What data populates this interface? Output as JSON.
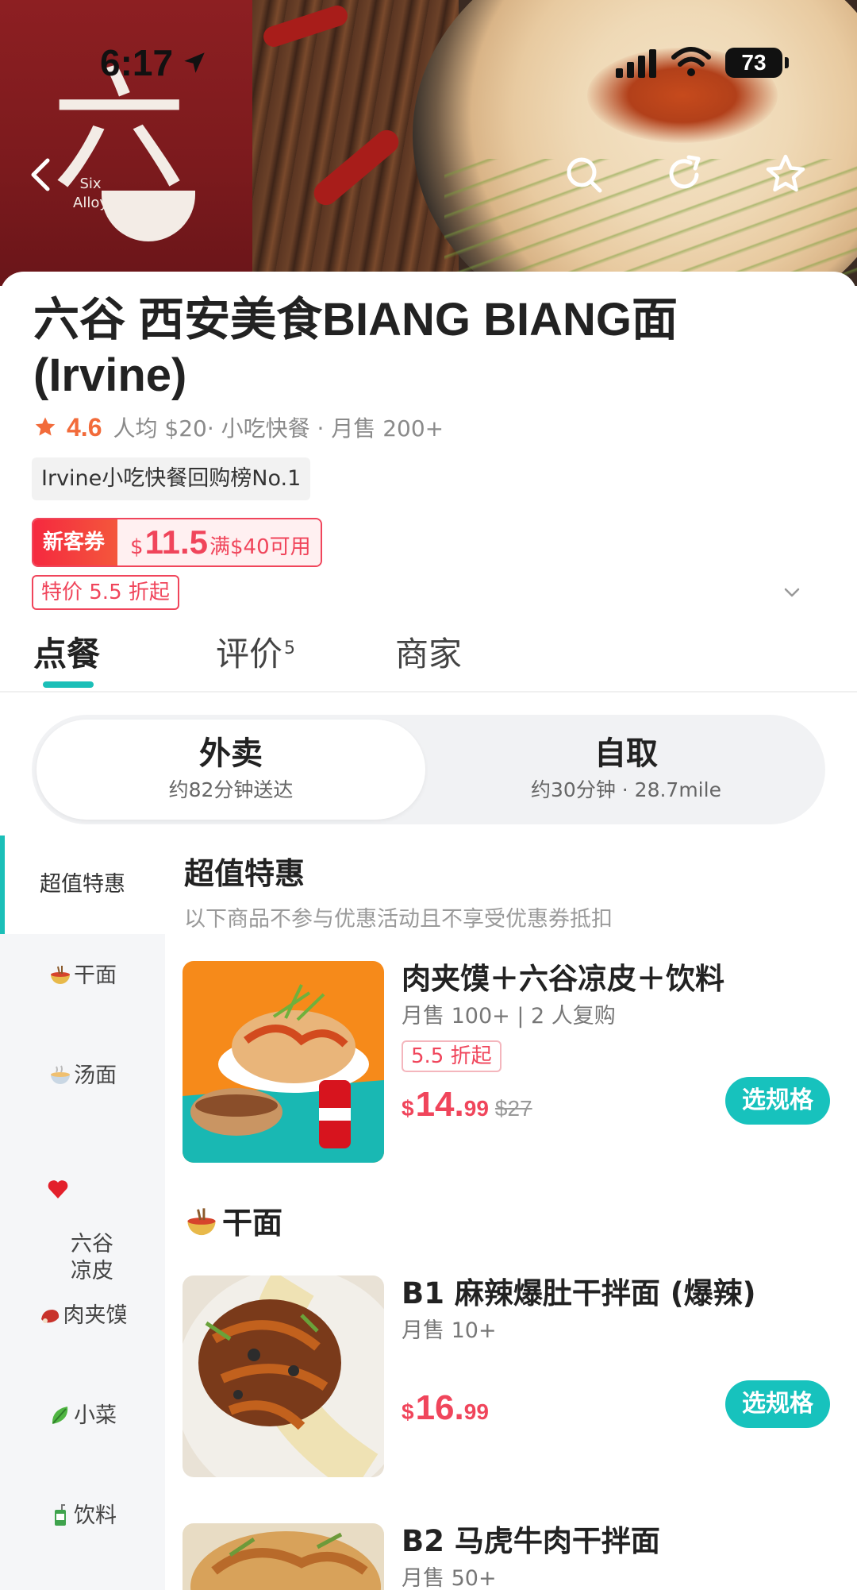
{
  "status_bar": {
    "time": "6:17",
    "battery": "73"
  },
  "hero": {
    "logo_glyph": "六",
    "logo_sub": "Six Alloy",
    "icons": [
      "back-icon",
      "search-icon",
      "share-icon",
      "favorite-star-icon"
    ]
  },
  "store": {
    "title": "六谷 西安美食BIANG BIANG面 (Irvine)",
    "rating": "4.6",
    "meta": "人均 $20· 小吃快餐 · 月售 200+",
    "rank_tag": "Irvine小吃快餐回购榜No.1",
    "coupon": {
      "label": "新客券",
      "currency": "$",
      "amount": "11.5",
      "condition": "满$40可用"
    },
    "discount_tag": "特价 5.5 折起"
  },
  "tabs": [
    {
      "label": "点餐",
      "badge": ""
    },
    {
      "label": "评价",
      "badge": "5"
    },
    {
      "label": "商家",
      "badge": ""
    }
  ],
  "order_modes": [
    {
      "title": "外卖",
      "subtitle": "约82分钟送达"
    },
    {
      "title": "自取",
      "subtitle": "约30分钟 · 28.7mile"
    }
  ],
  "categories": [
    {
      "label": "超值特惠",
      "icon": ""
    },
    {
      "label": "干面",
      "icon": "noodle-bowl-icon"
    },
    {
      "label": "汤面",
      "icon": "soup-bowl-icon"
    },
    {
      "label": "六谷\n凉皮",
      "icon": "red-heart-icon"
    },
    {
      "label": "肉夹馍",
      "icon": "meat-icon"
    },
    {
      "label": "小菜",
      "icon": "leafy-greens-icon"
    },
    {
      "label": "饮料",
      "icon": "juice-box-icon"
    }
  ],
  "sections": {
    "deals": {
      "title": "超值特惠",
      "note": "以下商品不参与优惠活动且不享受优惠券抵扣"
    },
    "dry_noodles": {
      "title": "干面",
      "icon": "noodle-bowl-icon"
    }
  },
  "items": [
    {
      "name": "肉夹馍＋六谷凉皮＋饮料",
      "sales": "月售 100+ | 2 人复购",
      "tag": "5.5 折起",
      "price_currency": "$",
      "price_int": "14.",
      "price_dec": "99",
      "price_orig": "$27",
      "button": "选规格"
    },
    {
      "name": "B1 麻辣爆肚干拌面 (爆辣)",
      "sales": "月售 10+",
      "price_currency": "$",
      "price_int": "16.",
      "price_dec": "99",
      "button": "选规格"
    },
    {
      "name": "B2 马虎牛肉干拌面",
      "sales": "月售 50+"
    }
  ],
  "colors": {
    "accent": "#1bbfb8",
    "price": "#f0455b",
    "rating": "#f26b3a",
    "brand_red": "#7b1a1d"
  }
}
